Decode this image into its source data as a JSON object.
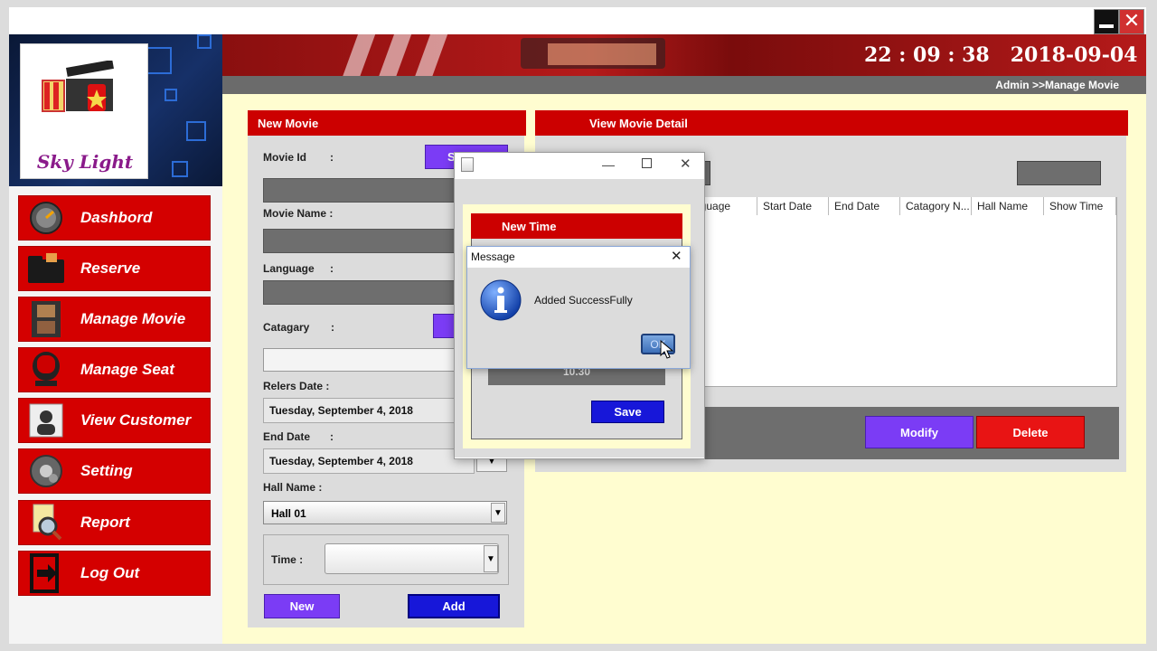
{
  "window": {
    "minimize_icon": "minimize-icon",
    "close_icon": "close-icon"
  },
  "brand": {
    "logo_text": "Sky Light"
  },
  "header": {
    "time": "22 : 09 : 38",
    "date": "2018-09-04",
    "breadcrumb": "Admin >>Manage Movie"
  },
  "sidebar": {
    "items": [
      {
        "label": "Dashbord",
        "icon": "dashboard-icon"
      },
      {
        "label": "Reserve",
        "icon": "folder-icon"
      },
      {
        "label": "Manage Movie",
        "icon": "film-icon"
      },
      {
        "label": "Manage Seat",
        "icon": "seat-icon"
      },
      {
        "label": "View Customer",
        "icon": "customer-icon"
      },
      {
        "label": "Setting",
        "icon": "gear-icon"
      },
      {
        "label": "Report",
        "icon": "report-icon"
      },
      {
        "label": "Log Out",
        "icon": "logout-icon"
      }
    ]
  },
  "new_movie": {
    "title": "New Movie",
    "movie_id_label": "Movie Id",
    "colon": ":",
    "search_btn_partial": "S",
    "movie_name_label": "Movie Name :",
    "language_label": "Language",
    "catagory_label": "Catagary",
    "release_date_label": "Relers Date :",
    "release_date_value": "Tuesday, September 4, 2018",
    "end_date_label": "End Date",
    "end_date_value": "Tuesday, September 4, 2018",
    "hall_name_label": "Hall Name :",
    "hall_value": "Hall 01",
    "time_label": "Time :",
    "new_btn": "New",
    "add_btn": "Add"
  },
  "view_movie": {
    "title": "View Movie Detail",
    "columns": [
      "nguage",
      "Start Date",
      "End Date",
      "Catagory N...",
      "Hall Name",
      "Show Time"
    ],
    "modify_btn": "Modify",
    "delete_btn": "Delete"
  },
  "new_time_dialog": {
    "title": "New Time",
    "time_value": "10.30",
    "save_btn": "Save"
  },
  "message_dialog": {
    "title": "Message",
    "text": "Added SuccessFully",
    "ok_btn": "OK",
    "icon": "info-icon"
  }
}
